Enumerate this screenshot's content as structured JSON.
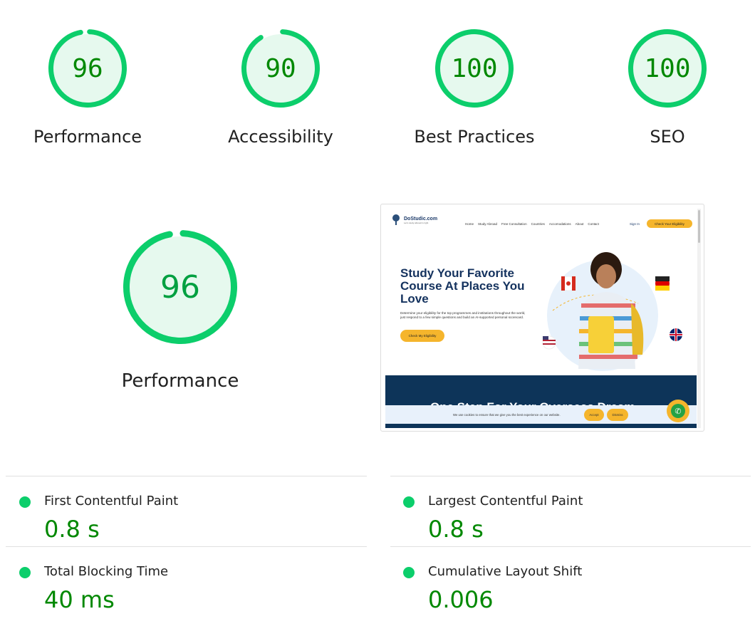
{
  "colors": {
    "pass_stroke": "#0cce6b",
    "pass_fill": "#e6f9ee",
    "pass_text": "#008800",
    "track": "#ffffff",
    "cta_yellow": "#f5b52c",
    "hero_navy": "#14325e",
    "band_navy": "#0d3459"
  },
  "categories": [
    {
      "score": "96",
      "value": 96,
      "label": "Performance"
    },
    {
      "score": "90",
      "value": 90,
      "label": "Accessibility"
    },
    {
      "score": "100",
      "value": 100,
      "label": "Best Practices"
    },
    {
      "score": "100",
      "value": 100,
      "label": "SEO"
    }
  ],
  "performance": {
    "score": "96",
    "value": 96,
    "label": "Performance"
  },
  "screenshot": {
    "logo_text": "DoStudic.com",
    "logo_sub": "Let's study abroad in right",
    "nav": [
      "Home",
      "Study Abroad",
      "Free Consultation",
      "Countries",
      "Accomodations",
      "About",
      "Contact"
    ],
    "sign_in": "Sign In",
    "cta": "Check Your Eligibility",
    "hero_title": "Study Your Favorite Course At Places You Love",
    "hero_desc": "Determine your eligibility for the top programmes and institutions throughout the world, just respond to a few simple questions and build an AI-supported personal scorecard.",
    "hero_button": "Check My Eligibility",
    "band_text": "One Step For Your Overseas Dream",
    "cookie_text": "We use cookies to ensure that we give you the best experience on our website.",
    "accept": "Accept",
    "dismiss": "Dismiss",
    "whatsapp_icon": "whatsapp-icon"
  },
  "metrics": [
    {
      "title": "First Contentful Paint",
      "value": "0.8 s"
    },
    {
      "title": "Largest Contentful Paint",
      "value": "0.8 s"
    },
    {
      "title": "Total Blocking Time",
      "value": "40 ms"
    },
    {
      "title": "Cumulative Layout Shift",
      "value": "0.006"
    }
  ]
}
